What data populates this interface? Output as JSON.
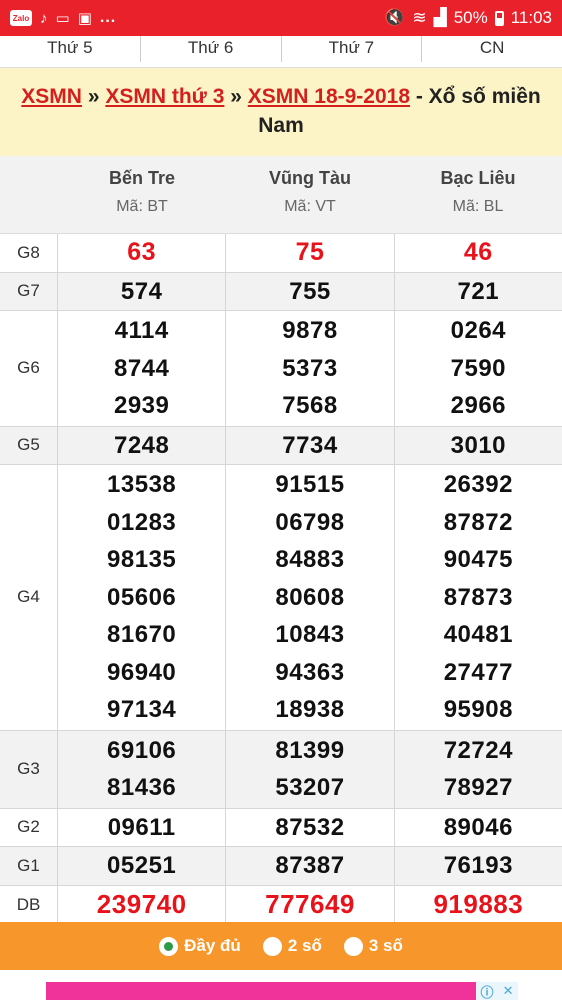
{
  "status_bar": {
    "battery": "50%",
    "time": "11:03",
    "zalo": "Zalo",
    "dots": "..."
  },
  "day_tabs": [
    "Thứ 5",
    "Thứ 6",
    "Thứ 7",
    "CN"
  ],
  "breadcrumb": {
    "link1": "XSMN",
    "sep1": " » ",
    "link2": "XSMN thứ 3",
    "sep2": " » ",
    "link3": "XSMN 18-9-2018",
    "suffix": " - Xổ số miền Nam"
  },
  "provinces": [
    {
      "name": "Bến Tre",
      "code": "Mã: BT"
    },
    {
      "name": "Vũng Tàu",
      "code": "Mã: VT"
    },
    {
      "name": "Bạc Liêu",
      "code": "Mã: BL"
    }
  ],
  "prizes": [
    {
      "label": "G8",
      "values": [
        [
          "63"
        ],
        [
          "75"
        ],
        [
          "46"
        ]
      ]
    },
    {
      "label": "G7",
      "values": [
        [
          "574"
        ],
        [
          "755"
        ],
        [
          "721"
        ]
      ]
    },
    {
      "label": "G6",
      "values": [
        [
          "4114",
          "8744",
          "2939"
        ],
        [
          "9878",
          "5373",
          "7568"
        ],
        [
          "0264",
          "7590",
          "2966"
        ]
      ]
    },
    {
      "label": "G5",
      "values": [
        [
          "7248"
        ],
        [
          "7734"
        ],
        [
          "3010"
        ]
      ]
    },
    {
      "label": "G4",
      "values": [
        [
          "13538",
          "01283",
          "98135",
          "05606",
          "81670",
          "96940",
          "97134"
        ],
        [
          "91515",
          "06798",
          "84883",
          "80608",
          "10843",
          "94363",
          "18938"
        ],
        [
          "26392",
          "87872",
          "90475",
          "87873",
          "40481",
          "27477",
          "95908"
        ]
      ]
    },
    {
      "label": "G3",
      "values": [
        [
          "69106",
          "81436"
        ],
        [
          "81399",
          "53207"
        ],
        [
          "72724",
          "78927"
        ]
      ]
    },
    {
      "label": "G2",
      "values": [
        [
          "09611"
        ],
        [
          "87532"
        ],
        [
          "89046"
        ]
      ]
    },
    {
      "label": "G1",
      "values": [
        [
          "05251"
        ],
        [
          "87387"
        ],
        [
          "76193"
        ]
      ]
    },
    {
      "label": "DB",
      "values": [
        [
          "239740"
        ],
        [
          "777649"
        ],
        [
          "919883"
        ]
      ]
    }
  ],
  "display_options": [
    {
      "label": "Đầy đủ",
      "selected": true
    },
    {
      "label": "2 số",
      "selected": false
    },
    {
      "label": "3 số",
      "selected": false
    }
  ],
  "colors": {
    "status_bar": "#e8212b",
    "title_bg": "#fcf4c6",
    "link": "#d41f1f",
    "special_prize": "#e8121a",
    "option_bar": "#f7962a"
  }
}
